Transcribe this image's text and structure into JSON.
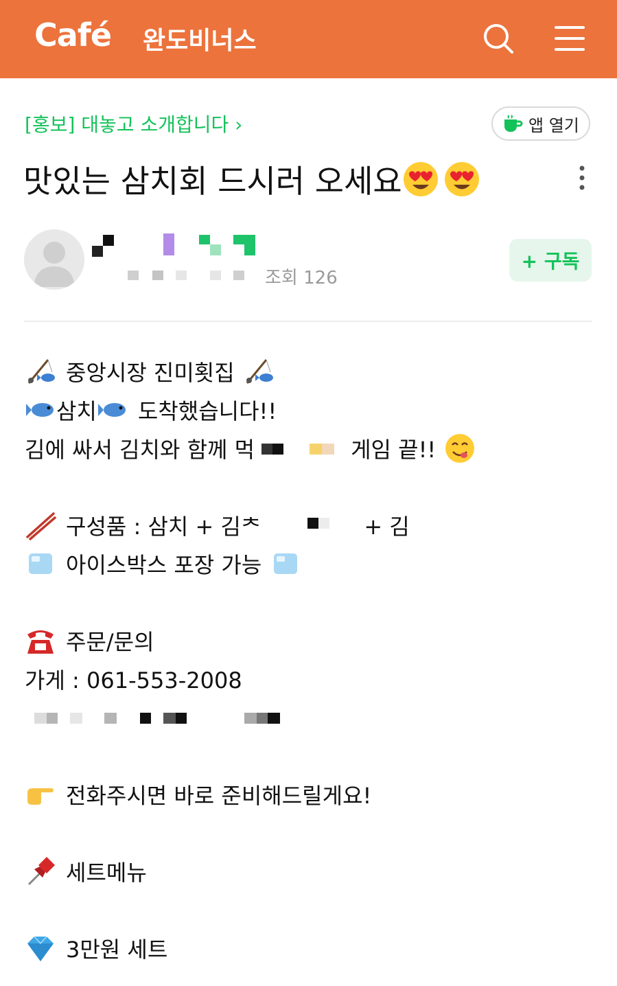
{
  "header": {
    "logo": "Café",
    "cafe_name": "완도비너스"
  },
  "post": {
    "board_link": "[홍보] 대놓고 소개합니다 ›",
    "app_open_label": "앱 열기",
    "title": "맛있는 삼치회 드시러 오세요",
    "views": "조회 126",
    "subscribe_label": "+ 구독",
    "body": {
      "line1": "중앙시장 진미횟집",
      "line2a": "삼치",
      "line2b": "도착했습니다!!",
      "line3a": "김에 싸서 김치와 함께 먹",
      "line3b": "게임 끝!!",
      "line4a": "구성품 : 삼치 + 김ᄎ",
      "line4b": "+ 김",
      "line5": "아이스박스 포장 가능",
      "line6": "주문/문의",
      "line7": "가게 : 061-553-2008",
      "line8": "전화주시면 바로 준비해드릴게요!",
      "line9": "세트메뉴",
      "line10": "3만원 세트"
    }
  },
  "colors": {
    "header_bg": "#EC733C",
    "accent_green": "#14C25A",
    "subscribe_bg": "#E6F6EC"
  },
  "icons": [
    "search-icon",
    "menu-icon",
    "cup-icon",
    "more-icon",
    "avatar-icon",
    "fishing-pole-icon",
    "fish-icon",
    "yum-face-icon",
    "chopsticks-icon",
    "ice-cube-icon",
    "telephone-icon",
    "pointing-hand-icon",
    "pushpin-icon",
    "gem-icon",
    "heart-eyes-icon"
  ]
}
